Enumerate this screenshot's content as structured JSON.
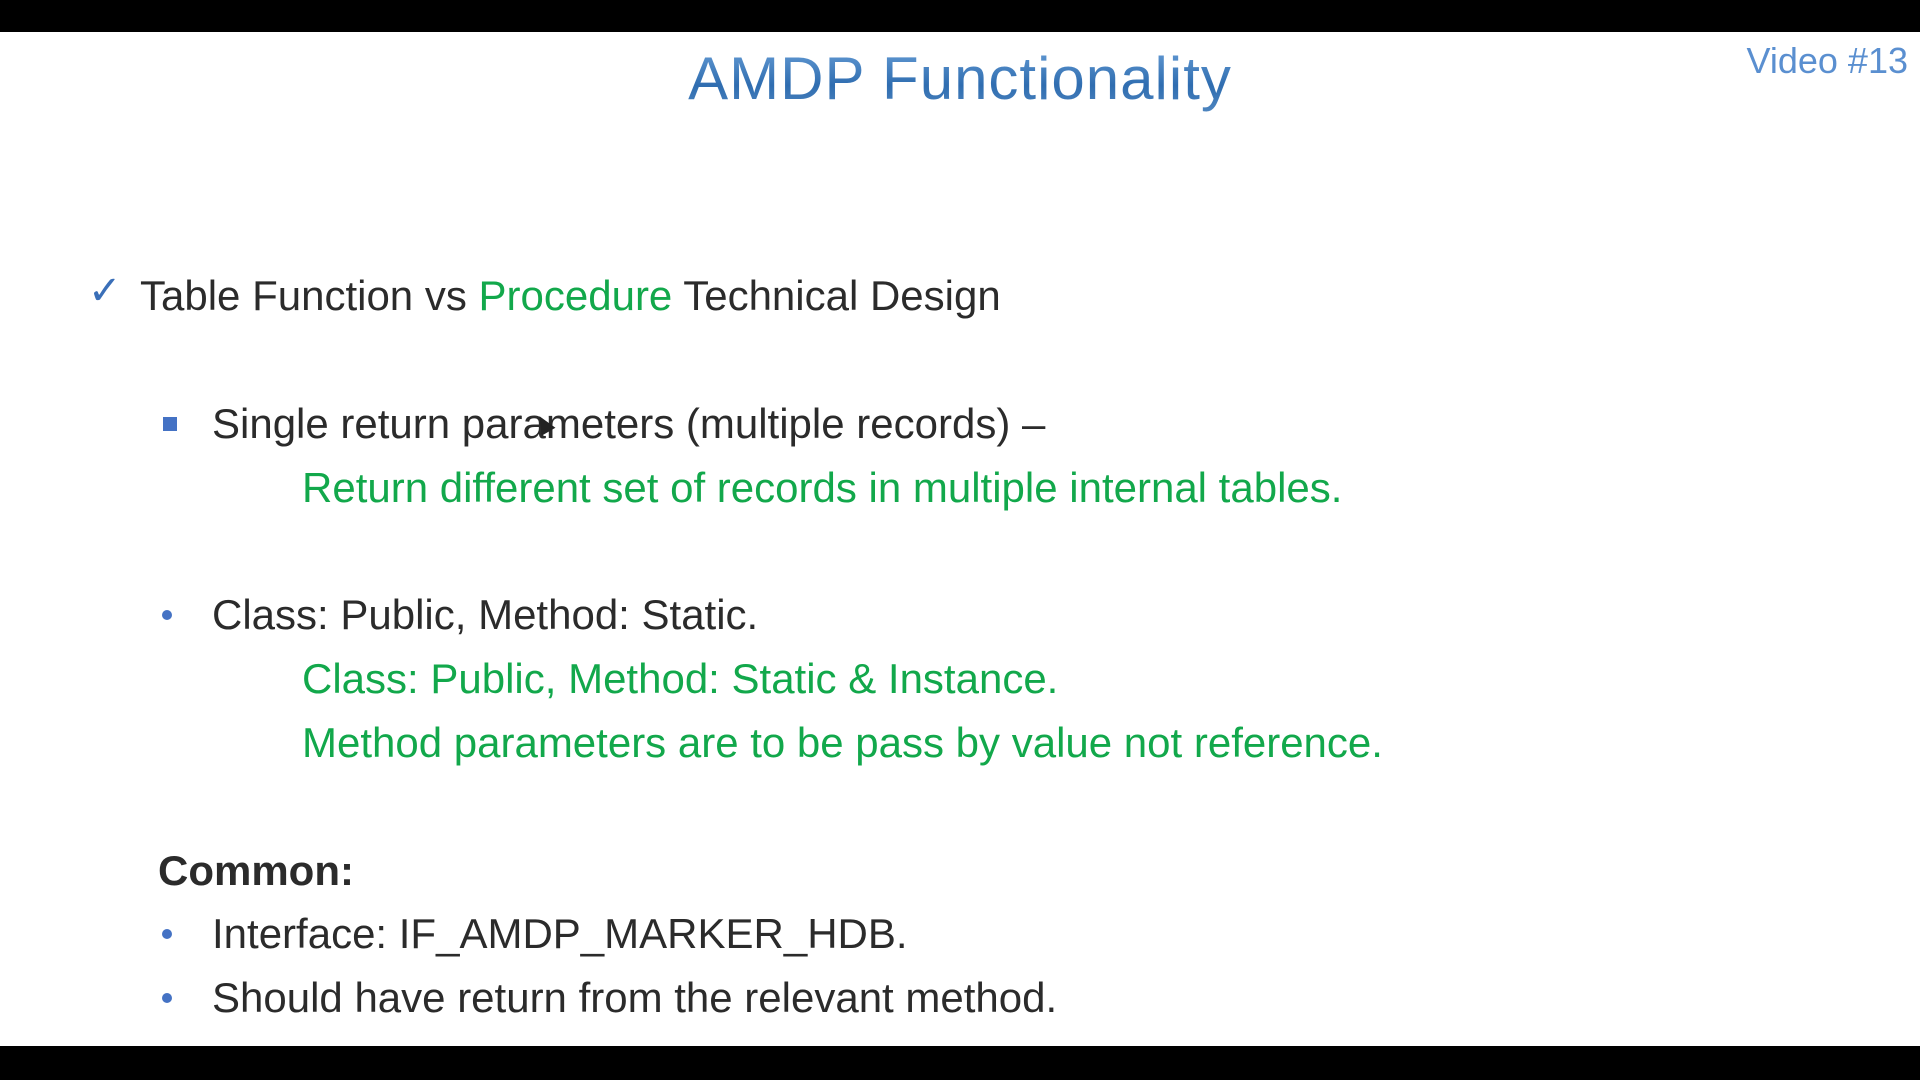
{
  "slide": {
    "title": "AMDP Functionality",
    "video_tag": "Video #13",
    "heading": {
      "part1": "Table Function vs ",
      "part2": "Procedure",
      "part3": " Technical Design"
    },
    "items": [
      {
        "text": "Single return parameters (multiple records) –",
        "details": [
          "Return different set of records in multiple internal tables."
        ]
      },
      {
        "text": "Class: Public, Method: Static.",
        "details": [
          "Class: Public, Method: Static & Instance.",
          "Method parameters are to be pass by value not reference."
        ]
      }
    ],
    "common": {
      "label": "Common:",
      "items": [
        "Interface: IF_AMDP_MARKER_HDB.",
        "Should have return from the relevant method."
      ]
    },
    "colors": {
      "title": "#4f86c0",
      "accent_green": "#12a84b",
      "bullet_blue": "#4472c4",
      "text": "#2b2b2b"
    }
  }
}
